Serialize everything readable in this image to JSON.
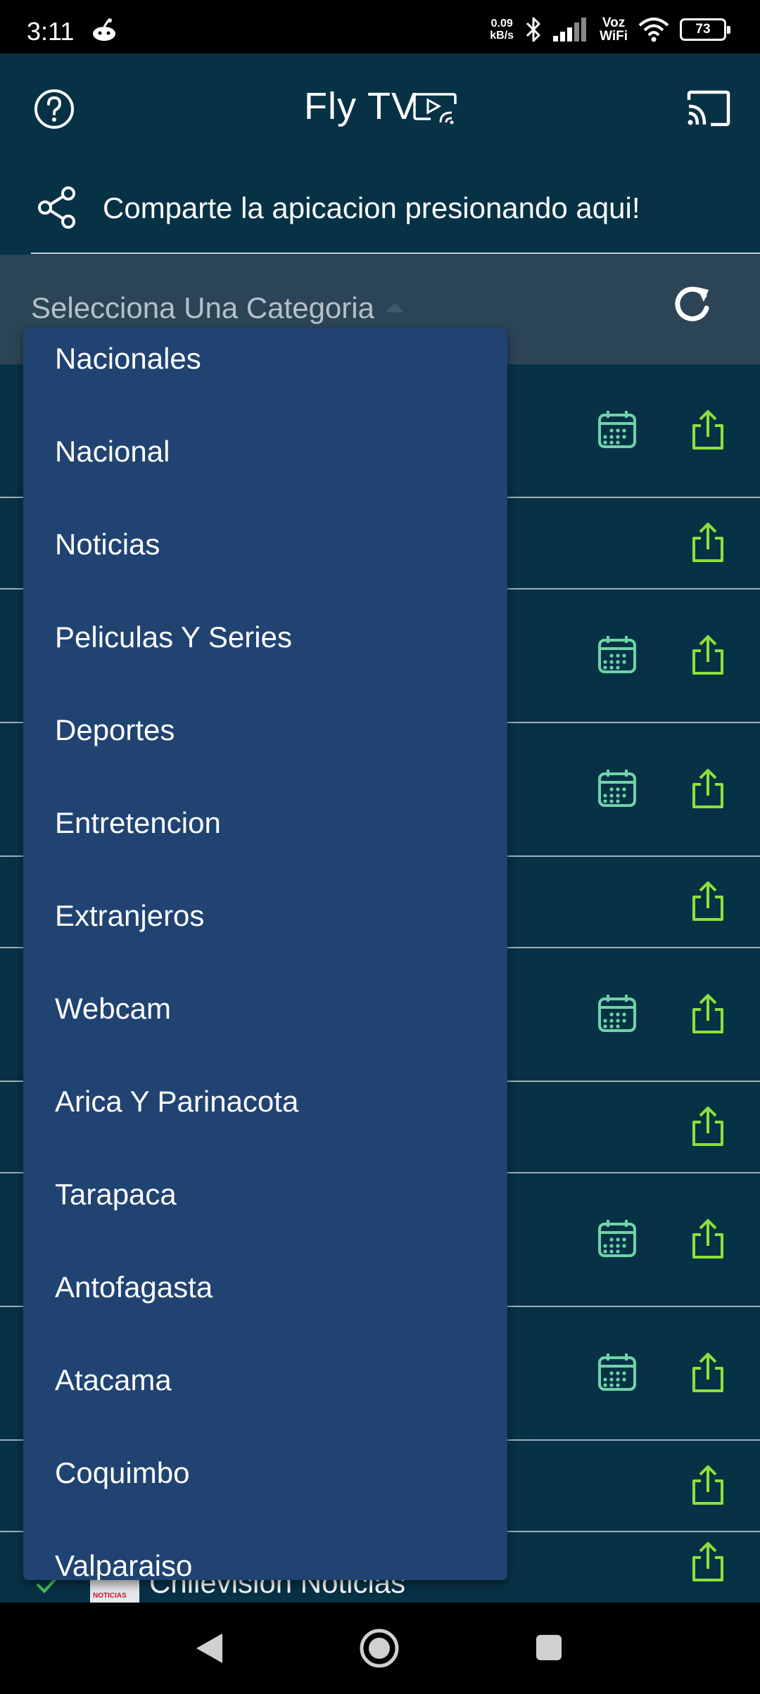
{
  "status_bar": {
    "time": "3:11",
    "net_speed_value": "0.09",
    "net_speed_unit": "kB/s",
    "vowifi_top": "Voz",
    "vowifi_bottom": "WiFi",
    "battery": "73"
  },
  "app_bar": {
    "title": "Fly TV"
  },
  "share": {
    "text": "Comparte la apicacion presionando aqui!"
  },
  "category": {
    "label": "Selecciona Una Categoria"
  },
  "dropdown": {
    "items": [
      "Nacionales",
      "Nacional",
      "Noticias",
      "Peliculas Y Series",
      "Deportes",
      "Entretencion",
      "Extranjeros",
      "Webcam",
      "Arica Y Parinacota",
      "Tarapaca",
      "Antofagasta",
      "Atacama",
      "Coquimbo",
      "Valparaiso"
    ]
  },
  "channel_list": {
    "last_row": {
      "logo_text": "NOTICIAS",
      "name": "Chilevision Noticias"
    }
  },
  "colors": {
    "background": "#073246",
    "category_bar": "#2c4556",
    "dropdown": "#204372",
    "calendar_icon": "#6fd3a8",
    "share_icon": "#8ee03a"
  }
}
